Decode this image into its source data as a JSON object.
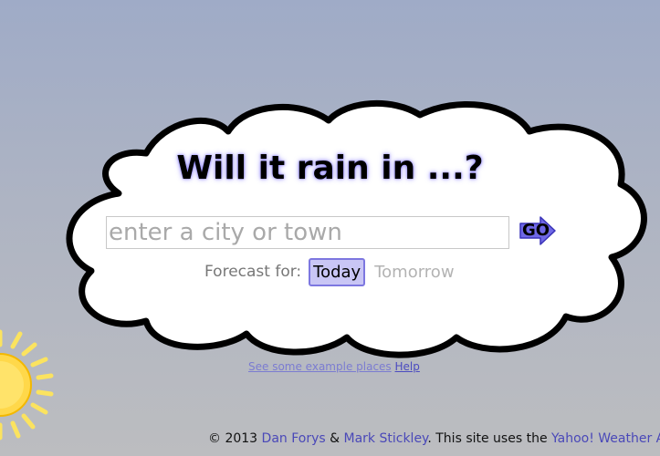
{
  "header": {
    "title": "Will it rain in ...?"
  },
  "search": {
    "placeholder": "enter a city or town",
    "value": "",
    "go_label": "GO"
  },
  "forecast": {
    "label": "Forecast for:",
    "options": [
      "Today",
      "Tomorrow"
    ],
    "selected": "Today"
  },
  "links": {
    "examples": "See some example places",
    "help": "Help"
  },
  "footer": {
    "copyright": "© 2013",
    "author1": "Dan Forys",
    "amp": "&",
    "author2": "Mark Stickley",
    "uses_text": ". This site uses the",
    "api_link": "Yahoo! Weather API"
  },
  "colors": {
    "accent": "#7d77e0",
    "active_bg": "#c9c6f5",
    "link": "#4a48b8",
    "sky_top": "#9fabc7",
    "sky_bottom": "#bcbdc0"
  },
  "icons": {
    "go": "arrow-right-icon",
    "sun": "sun-icon",
    "cloud": "cloud-shape"
  }
}
